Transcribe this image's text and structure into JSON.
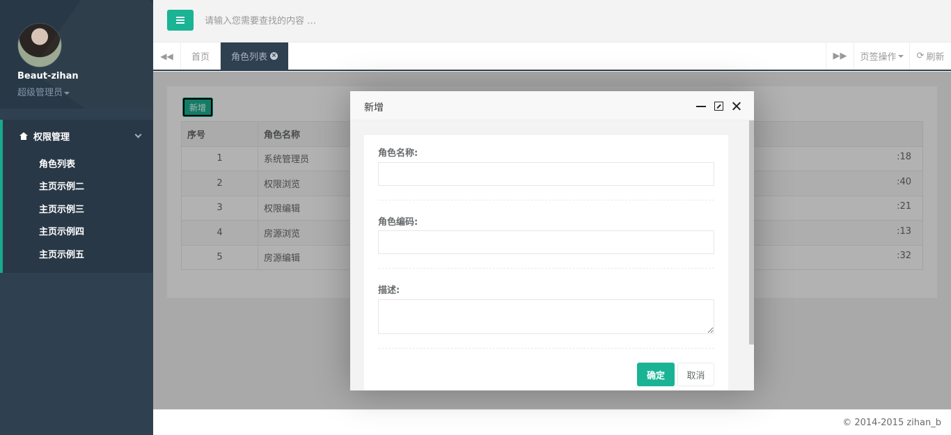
{
  "profile": {
    "name": "Beaut-zihan",
    "role": "超级管理员"
  },
  "sidebar": {
    "group_label": "权限管理",
    "items": [
      {
        "label": "角色列表"
      },
      {
        "label": "主页示例二"
      },
      {
        "label": "主页示例三"
      },
      {
        "label": "主页示例四"
      },
      {
        "label": "主页示例五"
      }
    ]
  },
  "topbar": {
    "search_placeholder": "请输入您需要查找的内容 …"
  },
  "tabs": {
    "home": "首页",
    "active": "角色列表",
    "ops": "页签操作",
    "refresh": "刷新"
  },
  "content": {
    "add_button": "新增",
    "table": {
      "headers": [
        "序号",
        "角色名称"
      ],
      "rows": [
        {
          "id": "1",
          "name": "系统管理员",
          "tail": ":18"
        },
        {
          "id": "2",
          "name": "权限浏览",
          "tail": ":40"
        },
        {
          "id": "3",
          "name": "权限编辑",
          "tail": ":21"
        },
        {
          "id": "4",
          "name": "房源浏览",
          "tail": ":13"
        },
        {
          "id": "5",
          "name": "房源编辑",
          "tail": ":32"
        }
      ]
    }
  },
  "modal": {
    "title": "新增",
    "fields": [
      {
        "label": "角色名称:"
      },
      {
        "label": "角色编码:"
      },
      {
        "label": "描述:"
      }
    ],
    "ok": "确定",
    "cancel": "取消"
  },
  "footer": {
    "text": "© 2014-2015 zihan_b"
  },
  "colors": {
    "accent": "#1ab394",
    "sidebar": "#2f4050"
  }
}
